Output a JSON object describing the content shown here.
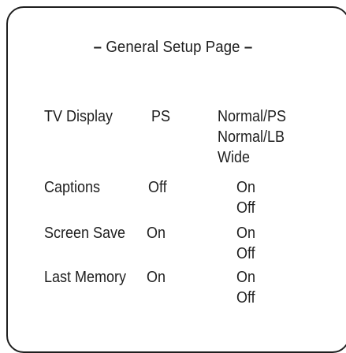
{
  "page": {
    "title_dash_left": "–",
    "title": "General Setup Page",
    "title_dash_right": "–"
  },
  "settings": [
    {
      "label": "TV Display",
      "current": "PS",
      "options": [
        "Normal/PS",
        "Normal/LB",
        "Wide"
      ]
    },
    {
      "label": "Captions",
      "current": "Off",
      "options": [
        "On",
        "Off"
      ]
    },
    {
      "label": "Screen Save",
      "current": "On",
      "options": [
        "On",
        "Off"
      ]
    },
    {
      "label": "Last Memory",
      "current": "On",
      "options": [
        "On",
        "Off"
      ]
    }
  ]
}
